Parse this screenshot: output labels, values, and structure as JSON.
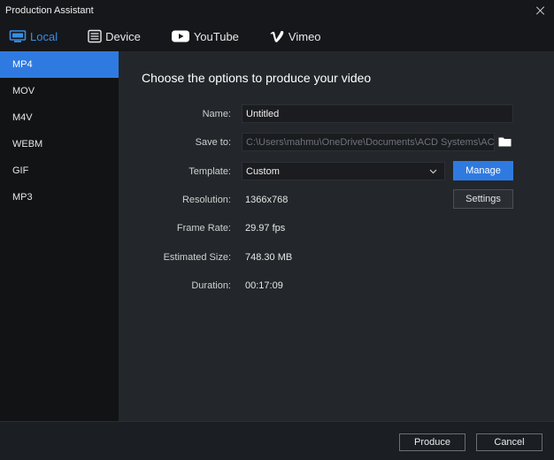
{
  "window": {
    "title": "Production Assistant"
  },
  "tabs": [
    {
      "label": "Local",
      "icon": "monitor-icon",
      "active": true
    },
    {
      "label": "Device",
      "icon": "device-icon",
      "active": false
    },
    {
      "label": "YouTube",
      "icon": "youtube-icon",
      "active": false
    },
    {
      "label": "Vimeo",
      "icon": "vimeo-icon",
      "active": false
    }
  ],
  "sidebar": {
    "items": [
      {
        "label": "MP4",
        "active": true
      },
      {
        "label": "MOV",
        "active": false
      },
      {
        "label": "M4V",
        "active": false
      },
      {
        "label": "WEBM",
        "active": false
      },
      {
        "label": "GIF",
        "active": false
      },
      {
        "label": "MP3",
        "active": false
      }
    ]
  },
  "main": {
    "heading": "Choose the options to produce your video",
    "name": {
      "label": "Name:",
      "value": "Untitled"
    },
    "save_to": {
      "label": "Save to:",
      "value": "C:\\Users\\mahmu\\OneDrive\\Documents\\ACD Systems\\ACDSee"
    },
    "template": {
      "label": "Template:",
      "value": "Custom",
      "manage_label": "Manage"
    },
    "resolution": {
      "label": "Resolution:",
      "value": "1366x768",
      "settings_label": "Settings"
    },
    "frame_rate": {
      "label": "Frame Rate:",
      "value": "29.97 fps"
    },
    "estimated_size": {
      "label": "Estimated Size:",
      "value": "748.30 MB"
    },
    "duration": {
      "label": "Duration:",
      "value": "00:17:09"
    }
  },
  "footer": {
    "produce_label": "Produce",
    "cancel_label": "Cancel"
  },
  "colors": {
    "accent": "#2f7ae0",
    "tab_active": "#3a8ee6",
    "background": "#23272b",
    "sidebar": "#111315"
  }
}
